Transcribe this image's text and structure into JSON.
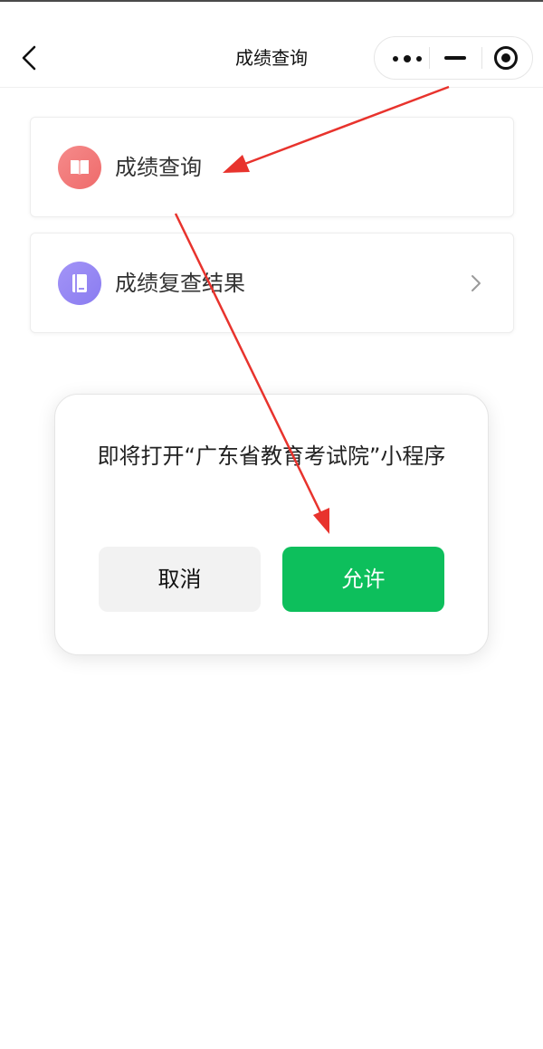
{
  "nav": {
    "title": "成绩查询"
  },
  "menu": {
    "items": [
      {
        "label": "成绩查询",
        "icon": "book-icon",
        "color": "#ef6b6b"
      },
      {
        "label": "成绩复查结果",
        "icon": "notebook-icon",
        "color": "#8a7cf0"
      }
    ]
  },
  "dialog": {
    "message": "即将打开“广东省教育考试院”小程序",
    "cancel_label": "取消",
    "allow_label": "允许",
    "allow_color": "#0dbf5c"
  },
  "annotation": {
    "arrow_color": "#e8332d"
  }
}
